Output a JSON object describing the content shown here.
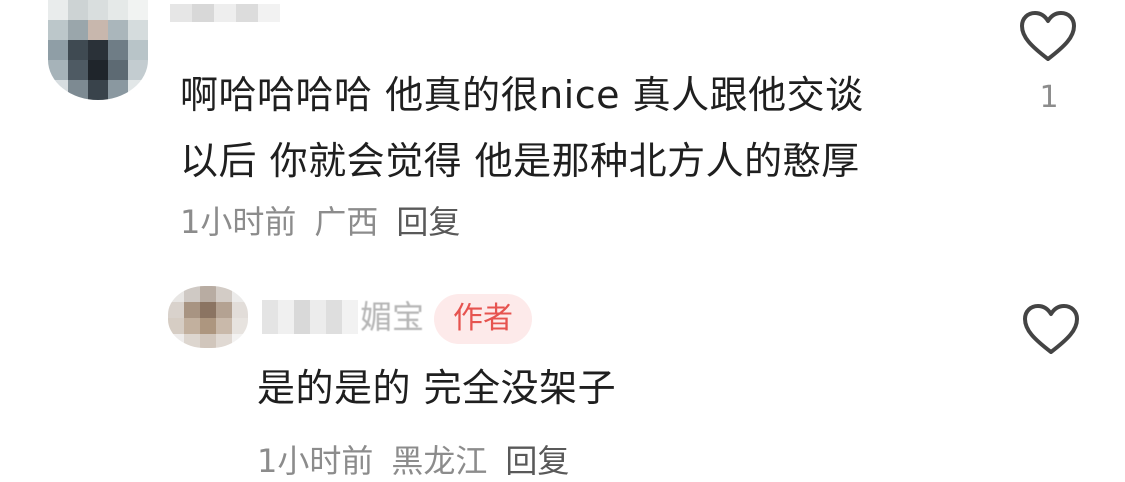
{
  "comments": [
    {
      "text_line1": "啊哈哈哈哈 他真的很nice 真人跟他交谈",
      "text_line2": "以后 你就会觉得 他是那种北方人的憨厚",
      "time": "1小时前",
      "location": "广西",
      "reply_label": "回复",
      "like_count": "1",
      "like_icon": "heart-outline-icon"
    },
    {
      "username_partial": "媚宝",
      "author_badge": "作者",
      "text": "是的是的 完全没架子",
      "time": "1小时前",
      "location": "黑龙江",
      "reply_label": "回复",
      "like_icon": "heart-outline-icon"
    }
  ],
  "colors": {
    "text": "#1f1f1f",
    "meta": "#8c8c8c",
    "badge_bg": "#fdeaea",
    "badge_text": "#e6534f",
    "icon": "#444444"
  }
}
